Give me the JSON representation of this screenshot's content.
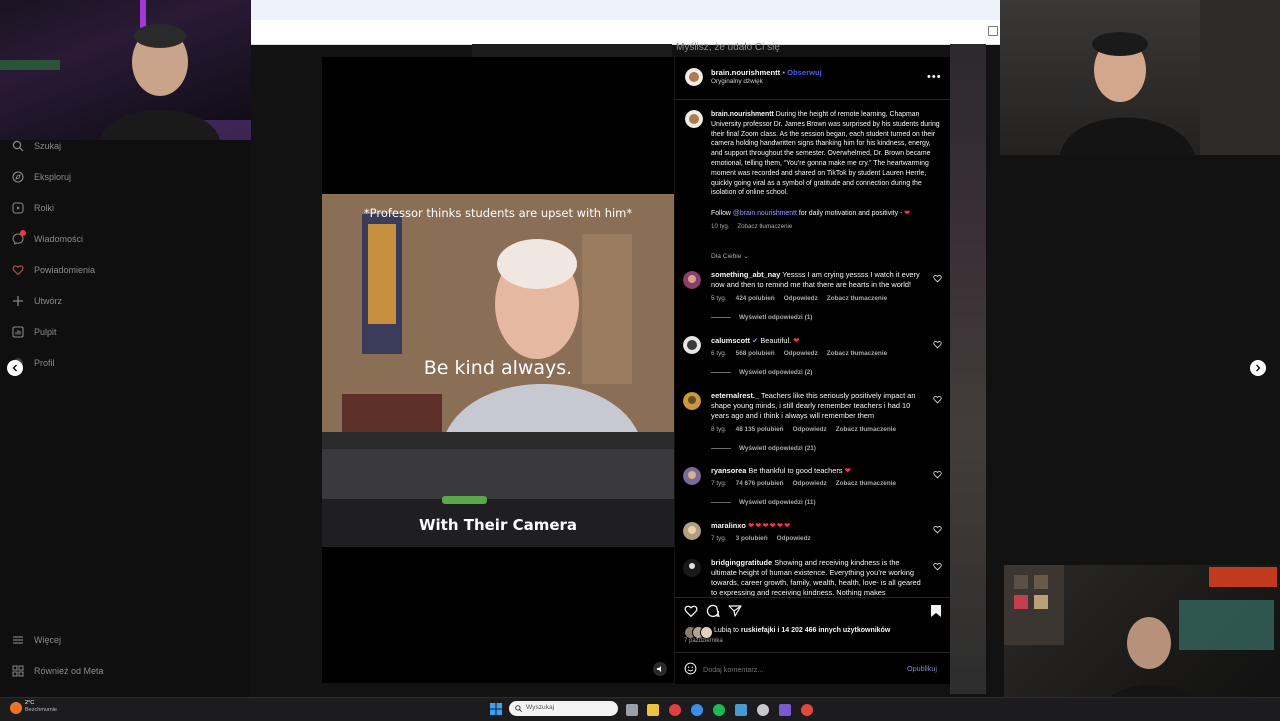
{
  "sidebar": {
    "items": [
      {
        "label": "Szukaj",
        "icon": "search-icon"
      },
      {
        "label": "Eksploruj",
        "icon": "compass-icon"
      },
      {
        "label": "Rolki",
        "icon": "reels-icon"
      },
      {
        "label": "Wiadomości",
        "icon": "messenger-icon"
      },
      {
        "label": "Powiadomienia",
        "icon": "heart-icon"
      },
      {
        "label": "Utwórz",
        "icon": "plus-icon"
      },
      {
        "label": "Pulpit",
        "icon": "dashboard-icon"
      },
      {
        "label": "Profil",
        "icon": "profile-icon"
      }
    ],
    "more_label": "Więcej",
    "meta_label": "Również od Meta"
  },
  "background": {
    "caption": "Myślisz, że udało Ci się"
  },
  "reel": {
    "caption_top": "*Professor thinks students are upset with him*",
    "caption_middle": "Be kind always.",
    "caption_bottom": "With Their Camera"
  },
  "post": {
    "username": "brain.nourishmentt",
    "follow_label": "Obserwuj",
    "audio_label": "Oryginalny dźwięk",
    "separator": "•",
    "description": "During the height of remote learning, Chapman University professor Dr. James Brown was surprised by his students during their final Zoom class. As the session began, each student turned on their camera holding handwritten signs thanking him for his kindness, energy, and support throughout the semester. Overwhelmed, Dr. Brown became emotional, telling them, “You’re gonna make me cry.” The heartwarming moment was recorded and shared on TikTok by student Lauren Herrle, quickly going viral as a symbol of gratitude and connection during the isolation of online school.",
    "follow_prefix": "Follow",
    "follow_handle": "@brain.nourishmentt",
    "follow_suffix": "for daily motivation and positivity -",
    "time": "10 tyg.",
    "see_translation": "Zobacz tłumaczenie",
    "sort_label": "Dla Ciebie"
  },
  "comments": [
    {
      "username": "something_abt_nay",
      "text": "Yessss I am crying yessss I watch it every now and then to remind me that there are hearts in the world!",
      "time": "5 tyg.",
      "likes": "424 polubień",
      "reply": "Odpowiedz",
      "translate": "Zobacz tłumaczenie",
      "replies": "Wyświetl odpowiedzi (1)"
    },
    {
      "username": "calumscott",
      "text": "Beautiful.",
      "time": "6 tyg.",
      "likes": "568 polubień",
      "reply": "Odpowiedz",
      "translate": "Zobacz tłumaczenie",
      "replies": "Wyświetl odpowiedzi (2)"
    },
    {
      "username": "eeternalrest._",
      "text": "Teachers like this seriously positively impact an shape young minds, i still dearly remember teachers i had 10 years ago and i think i always will remember them",
      "time": "8 tyg.",
      "likes": "48 135 polubień",
      "reply": "Odpowiedz",
      "translate": "Zobacz tłumaczenie",
      "replies": "Wyświetl odpowiedzi (21)"
    },
    {
      "username": "ryansorea",
      "text": "Be thankful to good teachers",
      "time": "7 tyg.",
      "likes": "74 676 polubień",
      "reply": "Odpowiedz",
      "translate": "Zobacz tłumaczenie",
      "replies": "Wyświetl odpowiedzi (11)"
    },
    {
      "username": "maralinxo",
      "text": "",
      "time": "7 tyg.",
      "likes": "3 polubień",
      "reply": "Odpowiedz",
      "translate": "",
      "replies": ""
    },
    {
      "username": "bridginggratitude",
      "text": "Showing and receiving kindness is the ultimate height of human existence. Everything you’re working towards, career growth, family, wealth, health, love- is all geared to expressing and receiving kindness. Nothing makes",
      "time": "",
      "likes": "",
      "reply": "",
      "translate": "",
      "replies": ""
    }
  ],
  "actions": {
    "liked_prefix": "Lubią to",
    "liked_user": "ruskiefajki",
    "liked_suffix": "i 14 202 466 innych użytkowników",
    "date": "7 października",
    "comment_placeholder": "Dodaj komentarz...",
    "publish_label": "Opublikuj"
  },
  "taskbar": {
    "weather_temp": "2°C",
    "weather_desc": "Bezchmurnie",
    "search_placeholder": "Wyszukaj"
  },
  "colors": {
    "accent_blue": "#4a5df9",
    "heart_red": "#ff3040"
  }
}
